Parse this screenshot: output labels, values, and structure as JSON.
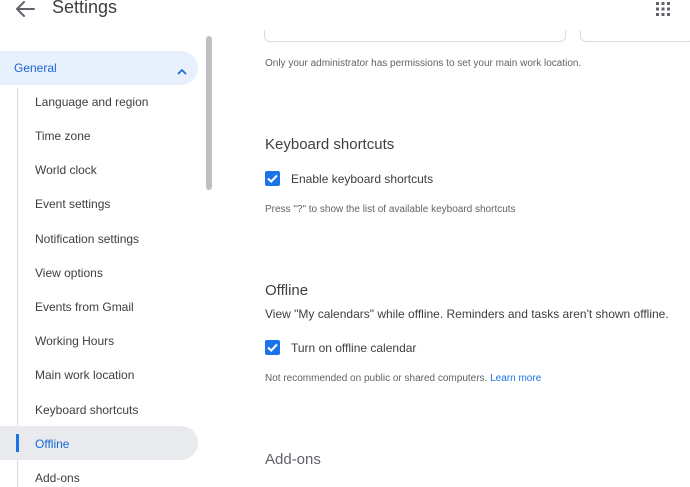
{
  "header": {
    "title": "Settings",
    "back_icon": "arrow-back-icon",
    "apps_icon": "apps-grid-icon"
  },
  "sidebar": {
    "section": "General",
    "items": [
      {
        "label": "Language and region"
      },
      {
        "label": "Time zone"
      },
      {
        "label": "World clock"
      },
      {
        "label": "Event settings"
      },
      {
        "label": "Notification settings"
      },
      {
        "label": "View options"
      },
      {
        "label": "Events from Gmail"
      },
      {
        "label": "Working Hours"
      },
      {
        "label": "Main work location"
      },
      {
        "label": "Keyboard shortcuts"
      },
      {
        "label": "Offline",
        "selected": true
      },
      {
        "label": "Add-ons"
      }
    ]
  },
  "main": {
    "work_location_note": "Only your administrator has permissions to set your main work location.",
    "keyboard": {
      "heading": "Keyboard shortcuts",
      "checkbox_label": "Enable keyboard shortcuts",
      "checked": true,
      "hint": "Press \"?\" to show the list of available keyboard shortcuts"
    },
    "offline": {
      "heading": "Offline",
      "description": "View \"My calendars\" while offline. Reminders and tasks aren't shown offline.",
      "checkbox_label": "Turn on offline calendar",
      "checked": true,
      "hint": "Not recommended on public or shared computers.",
      "learn_more": "Learn more"
    },
    "addons": {
      "heading": "Add-ons"
    }
  },
  "colors": {
    "accent": "#1a73e8",
    "selected_bg": "#e8f0fe",
    "active_bg": "#e8eaed"
  }
}
